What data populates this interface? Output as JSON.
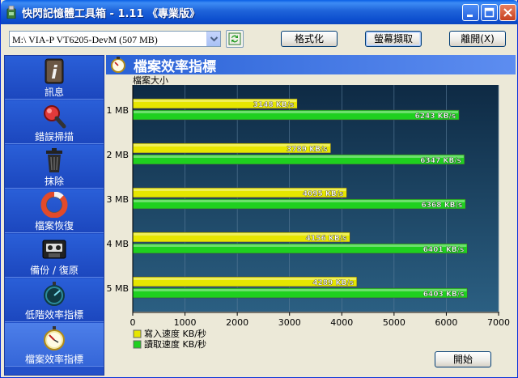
{
  "window": {
    "title": "快閃記憶體工具箱 - 1.11 《專業版》"
  },
  "toolbar": {
    "device_value": "M:\\ VIA-P   VT6205-DevM (507 MB)",
    "format_label": "格式化",
    "screenshot_label": "螢幕擷取",
    "exit_label": "離開(X)"
  },
  "sidebar": {
    "items": [
      {
        "label": "訊息",
        "icon": "info-icon"
      },
      {
        "label": "錯誤掃描",
        "icon": "magnifier-icon"
      },
      {
        "label": "抹除",
        "icon": "trash-icon"
      },
      {
        "label": "檔案恢復",
        "icon": "lifebuoy-icon"
      },
      {
        "label": "備份 / 復原",
        "icon": "cassette-icon"
      },
      {
        "label": "低階效率指標",
        "icon": "stopwatch-icon"
      },
      {
        "label": "檔案效率指標",
        "icon": "stopwatch-icon"
      }
    ],
    "active_index": 6
  },
  "panel": {
    "title": "檔案效率指標",
    "start_label": "開始"
  },
  "colors": {
    "write": "#e6e600",
    "read": "#1fd01f",
    "plot_bg_top": "#0e2a44",
    "plot_bg_bottom": "#2b5f82"
  },
  "chart_data": {
    "type": "bar",
    "orientation": "horizontal",
    "ylabel": "檔案大小",
    "categories": [
      "1 MB",
      "2 MB",
      "3 MB",
      "4 MB",
      "5 MB"
    ],
    "series": [
      {
        "name": "寫入速度 KB/秒",
        "values": [
          3148,
          3789,
          4095,
          4156,
          4289
        ],
        "value_labels": [
          "3148 KB/s",
          "3789 KB/s",
          "4095 KB/s",
          "4156 KB/s",
          "4289 KB/s"
        ]
      },
      {
        "name": "讀取速度 KB/秒",
        "values": [
          6243,
          6347,
          6368,
          6401,
          6403
        ],
        "value_labels": [
          "6243 KB/s",
          "6347 KB/s",
          "6368 KB/s",
          "6401 KB/s",
          "6403 KB/s"
        ]
      }
    ],
    "xlim": [
      0,
      7000
    ],
    "xticks": [
      "0",
      "1000",
      "2000",
      "3000",
      "4000",
      "5000",
      "6000",
      "7000"
    ],
    "legend_position": "bottom-left"
  }
}
